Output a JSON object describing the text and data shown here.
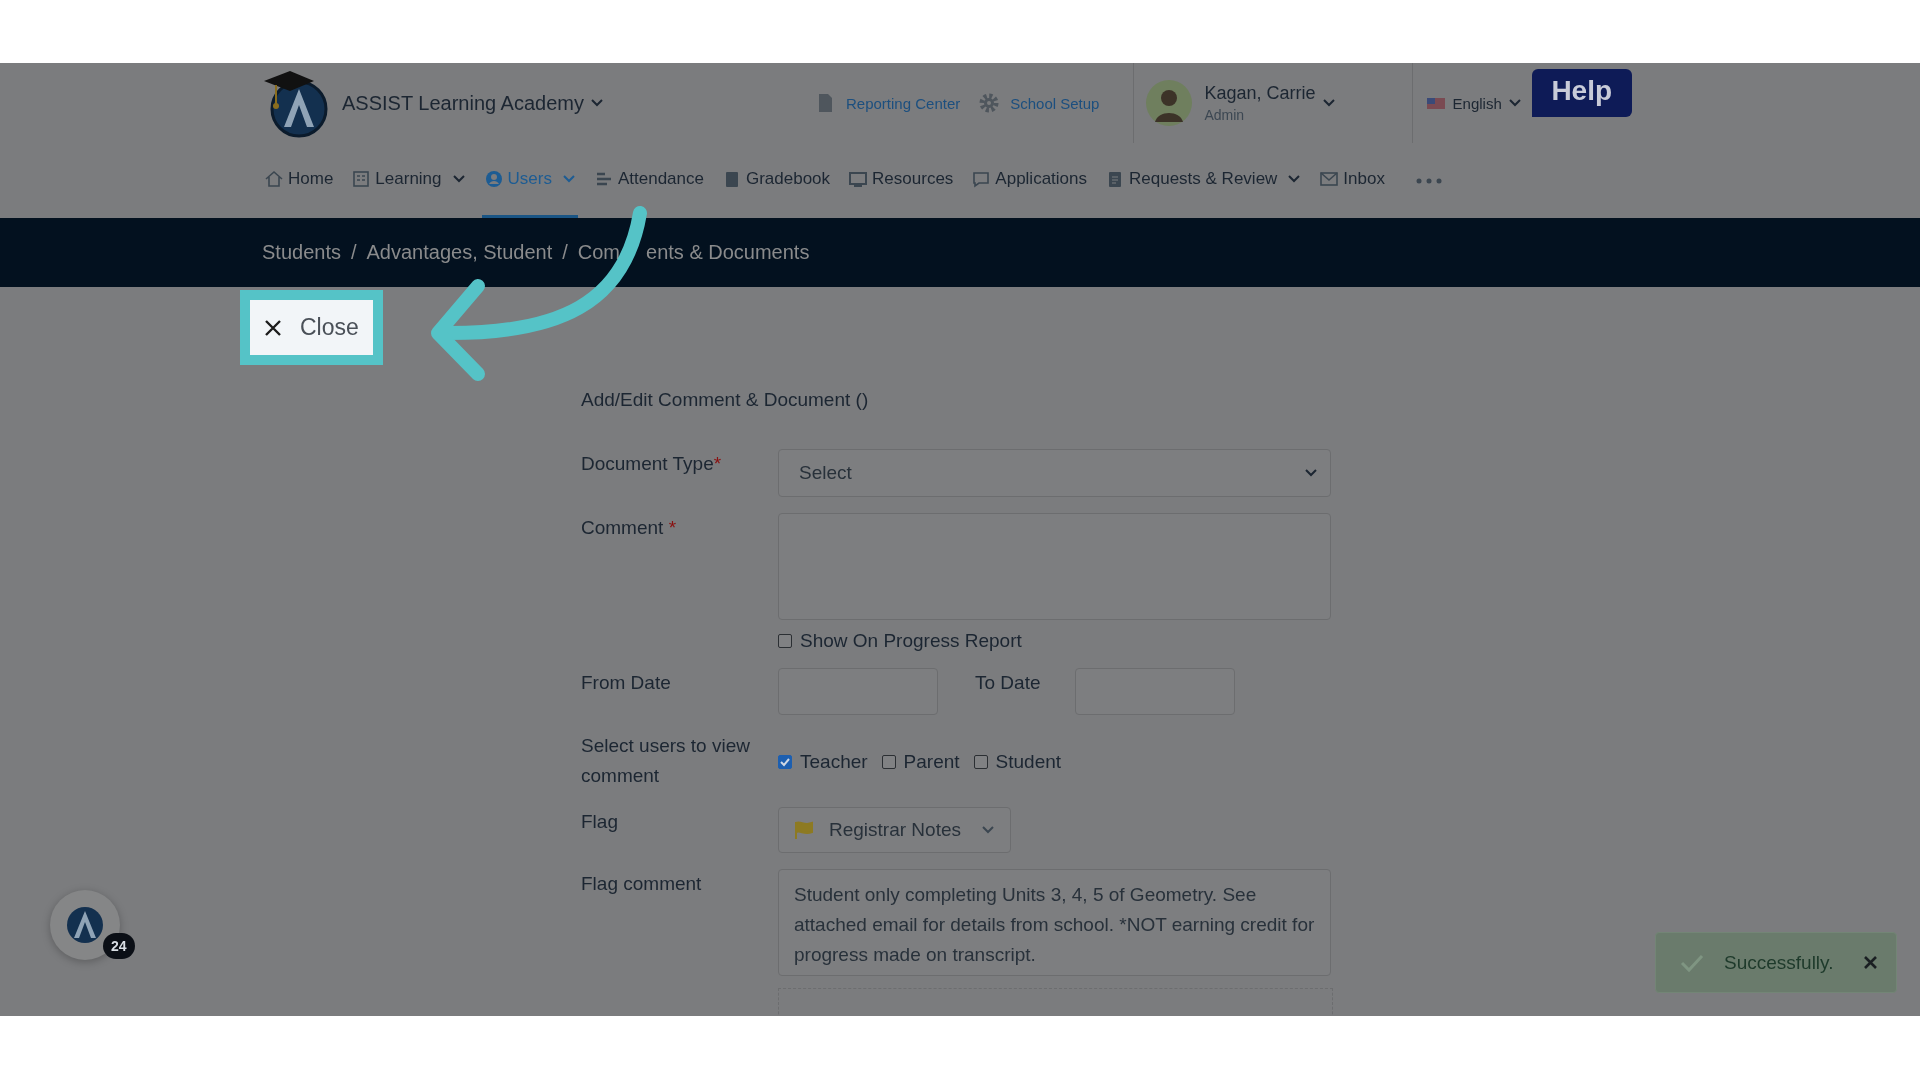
{
  "header": {
    "school": "ASSIST Learning Academy",
    "links": [
      "Reporting Center",
      "School Setup"
    ],
    "user": {
      "name": "Kagan, Carrie",
      "role": "Admin"
    },
    "language": "English",
    "help": "Help"
  },
  "nav": [
    {
      "label": "Home",
      "selected": false,
      "dropdown": false
    },
    {
      "label": "Learning",
      "selected": false,
      "dropdown": true
    },
    {
      "label": "Users",
      "selected": true,
      "dropdown": true
    },
    {
      "label": "Attendance",
      "selected": false,
      "dropdown": false
    },
    {
      "label": "Gradebook",
      "selected": false,
      "dropdown": false
    },
    {
      "label": "Resources",
      "selected": false,
      "dropdown": false
    },
    {
      "label": "Applications",
      "selected": false,
      "dropdown": false
    },
    {
      "label": "Requests & Review",
      "selected": false,
      "dropdown": true
    },
    {
      "label": "Inbox",
      "selected": false,
      "dropdown": false
    }
  ],
  "breadcrumb": {
    "separator": "/",
    "items": [
      "Students",
      "Advantages, Student"
    ],
    "current_parts": [
      "Com",
      "ents & Documents"
    ]
  },
  "close_button": "Close",
  "form": {
    "title": "Add/Edit Comment & Document ()",
    "document_type": {
      "label": "Document Type",
      "required_mark": "*",
      "value": "Select"
    },
    "comment": {
      "label": "Comment",
      "required_mark": "*"
    },
    "progress_report": {
      "label": "Show On Progress Report",
      "checked": false
    },
    "from_date": {
      "label": "From Date"
    },
    "to_date": {
      "label": "To Date"
    },
    "visibility": {
      "label": "Select users to view comment",
      "options": [
        {
          "label": "Teacher",
          "checked": true
        },
        {
          "label": "Parent",
          "checked": false
        },
        {
          "label": "Student",
          "checked": false
        }
      ]
    },
    "flag": {
      "label": "Flag",
      "value": "Registrar Notes"
    },
    "flag_comment": {
      "label": "Flag comment",
      "value": "Student only completing Units 3, 4, 5 of Geometry. See attached email for details from school. *NOT earning credit for progress made on transcript."
    }
  },
  "chat_badge": {
    "count": "24"
  },
  "toast": {
    "message": "Successfully."
  }
}
